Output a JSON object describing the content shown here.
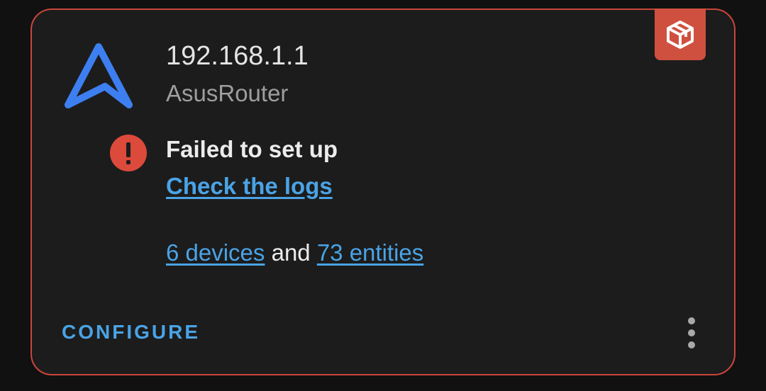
{
  "card": {
    "host": "192.168.1.1",
    "integration": "AsusRouter",
    "status": "Failed to set up",
    "logs_link": "Check the logs",
    "devices_link": "6 devices",
    "conjunction": " and ",
    "entities_link": "73 entities",
    "configure_label": "CONFIGURE",
    "badge_icon": "custom-integration-package-icon",
    "logo_icon": "asus-router-logo-icon",
    "status_icon": "error-exclamation-icon",
    "menu_icon": "overflow-menu-vertical-icon"
  },
  "colors": {
    "background": "#111111",
    "card": "#1c1c1c",
    "border_error": "#c9463a",
    "badge": "#d0503f",
    "link": "#4aa3e6",
    "logo": "#3d7ff0",
    "error_icon": "#db4a3b"
  }
}
